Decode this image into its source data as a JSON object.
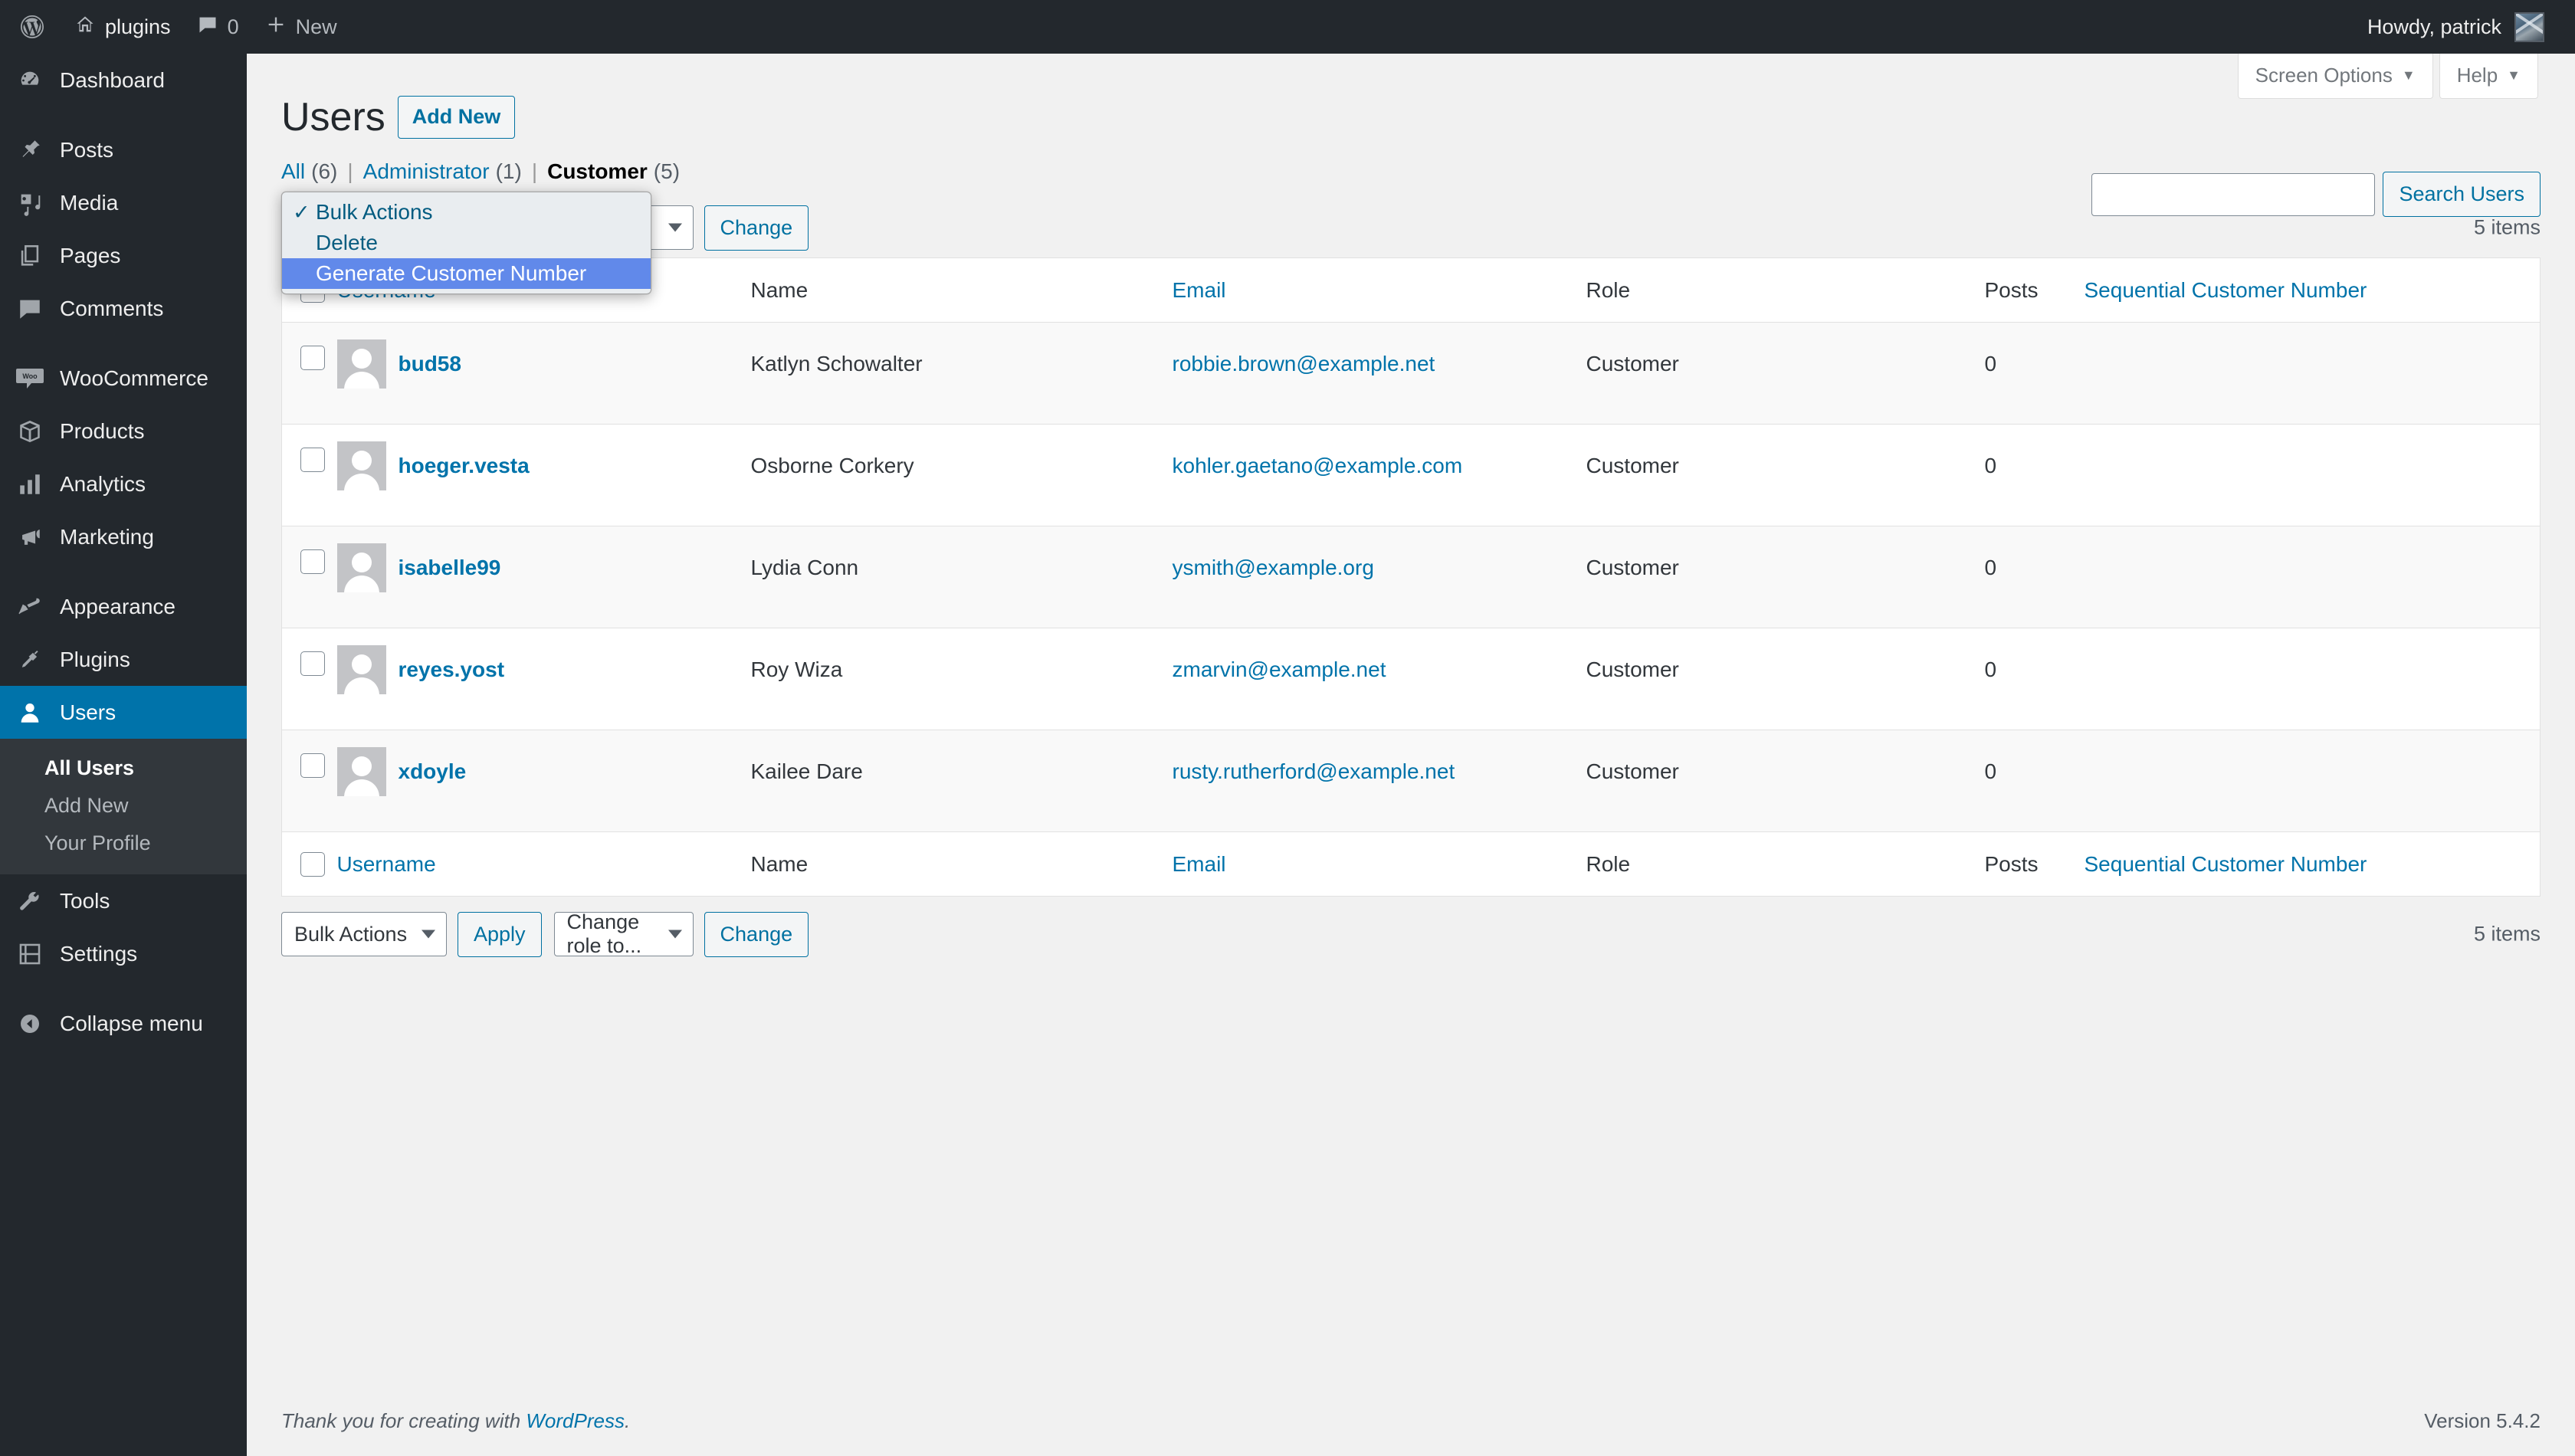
{
  "adminbar": {
    "logo_icon": "wordpress-logo-icon",
    "site_name": "plugins",
    "home_icon": "home-icon",
    "comments_icon": "comment-bubble-icon",
    "comment_count": "0",
    "new_icon": "plus-icon",
    "new_label": "New",
    "howdy": "Howdy, patrick",
    "avatar_icon": "user-avatar"
  },
  "sidebar": {
    "items": [
      {
        "label": "Dashboard",
        "icon": "dashboard-icon",
        "current": false
      },
      {
        "label": "Posts",
        "icon": "pin-icon",
        "current": false
      },
      {
        "label": "Media",
        "icon": "media-icon",
        "current": false
      },
      {
        "label": "Pages",
        "icon": "pages-icon",
        "current": false
      },
      {
        "label": "Comments",
        "icon": "comment-bubble-icon",
        "current": false
      },
      {
        "label": "WooCommerce",
        "icon": "woocommerce-icon",
        "current": false
      },
      {
        "label": "Products",
        "icon": "box-icon",
        "current": false
      },
      {
        "label": "Analytics",
        "icon": "bar-chart-icon",
        "current": false
      },
      {
        "label": "Marketing",
        "icon": "megaphone-icon",
        "current": false
      },
      {
        "label": "Appearance",
        "icon": "paintbrush-icon",
        "current": false
      },
      {
        "label": "Plugins",
        "icon": "plug-icon",
        "current": false
      },
      {
        "label": "Users",
        "icon": "user-icon",
        "current": true
      },
      {
        "label": "Tools",
        "icon": "wrench-icon",
        "current": false
      },
      {
        "label": "Settings",
        "icon": "settings-sliders-icon",
        "current": false
      },
      {
        "label": "Collapse menu",
        "icon": "collapse-arrow-icon",
        "current": false
      }
    ],
    "users_submenu": [
      {
        "label": "All Users",
        "current": true
      },
      {
        "label": "Add New",
        "current": false
      },
      {
        "label": "Your Profile",
        "current": false
      }
    ]
  },
  "screen_meta": {
    "screen_options": "Screen Options",
    "help": "Help",
    "caret": "▼"
  },
  "page": {
    "title": "Users",
    "add_new": "Add New"
  },
  "filters": [
    {
      "label": "All",
      "count": "(6)",
      "current": false
    },
    {
      "label": "Administrator",
      "count": "(1)",
      "current": false
    },
    {
      "label": "Customer",
      "count": "(5)",
      "current": true
    }
  ],
  "search": {
    "value": "",
    "placeholder": "",
    "button": "Search Users"
  },
  "tablenav_top": {
    "bulk_select_value": "Bulk Actions",
    "apply_label": "Apply",
    "role_select_value": "Change role to...",
    "change_label": "Change",
    "displaying_num": "5 items"
  },
  "tablenav_bottom": {
    "bulk_select_value": "Bulk Actions",
    "apply_label": "Apply",
    "role_select_value": "Change role to...",
    "change_label": "Change",
    "displaying_num": "5 items"
  },
  "open_dropdown": {
    "options": [
      {
        "label": "Bulk Actions",
        "selected": true,
        "highlighted": false
      },
      {
        "label": "Delete",
        "selected": false,
        "highlighted": false
      },
      {
        "label": "Generate Customer Number",
        "selected": false,
        "highlighted": true
      }
    ],
    "check_glyph": "✓",
    "highlight_color": "#6189ea"
  },
  "table": {
    "columns": [
      {
        "key": "cb",
        "label": "",
        "link": false
      },
      {
        "key": "username",
        "label": "Username",
        "link": true
      },
      {
        "key": "name",
        "label": "Name",
        "link": false
      },
      {
        "key": "email",
        "label": "Email",
        "link": true
      },
      {
        "key": "role",
        "label": "Role",
        "link": false
      },
      {
        "key": "posts",
        "label": "Posts",
        "link": false
      },
      {
        "key": "seq",
        "label": "Sequential Customer Number",
        "link": true
      }
    ],
    "rows": [
      {
        "username": "bud58",
        "name": "Katlyn Schowalter",
        "email": "robbie.brown@example.net",
        "role": "Customer",
        "posts": "0",
        "seq": ""
      },
      {
        "username": "hoeger.vesta",
        "name": "Osborne Corkery",
        "email": "kohler.gaetano@example.com",
        "role": "Customer",
        "posts": "0",
        "seq": ""
      },
      {
        "username": "isabelle99",
        "name": "Lydia Conn",
        "email": "ysmith@example.org",
        "role": "Customer",
        "posts": "0",
        "seq": ""
      },
      {
        "username": "reyes.yost",
        "name": "Roy Wiza",
        "email": "zmarvin@example.net",
        "role": "Customer",
        "posts": "0",
        "seq": ""
      },
      {
        "username": "xdoyle",
        "name": "Kailee Dare",
        "email": "rusty.rutherford@example.net",
        "role": "Customer",
        "posts": "0",
        "seq": ""
      }
    ]
  },
  "footer": {
    "thankyou_prefix": "Thank you for creating with ",
    "thankyou_link": "WordPress",
    "thankyou_suffix": ".",
    "version": "Version 5.4.2"
  },
  "colors": {
    "admin_dark": "#23282d",
    "submenu_dark": "#32373c",
    "accent_blue": "#0073aa",
    "link_blue": "#0071a1",
    "page_bg": "#f1f1f1",
    "highlight_blue": "#6189ea"
  }
}
